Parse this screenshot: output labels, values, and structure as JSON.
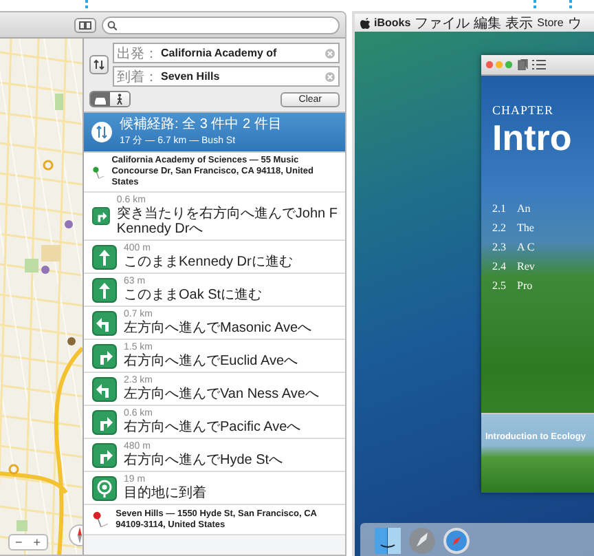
{
  "maps_window": {
    "map": {
      "zoom_out": "−",
      "zoom_in": "+"
    },
    "directions": {
      "from": {
        "label": "出発：",
        "value": "California Academy of"
      },
      "to": {
        "label": "到着：",
        "value": "Seven Hills"
      },
      "modes": [
        {
          "kind": "car",
          "selected": true
        },
        {
          "kind": "walk",
          "selected": false
        }
      ],
      "clear": "Clear",
      "route": {
        "title": "候補経路: 全 3 件中 2 件目",
        "detail": "17 分 — 6.7 km — Bush St",
        "selected": true
      },
      "start": "California Academy of Sciences — 55 Music Concourse Dr, San Francisco, CA  94118, United States",
      "steps": [
        {
          "kind": "right",
          "distance": "0.6 km",
          "instruction": "突き当たりを右方向へ進んでJohn F Kennedy Drへ"
        },
        {
          "kind": "straight",
          "distance": "400 m",
          "instruction": "このままKennedy Drに進む"
        },
        {
          "kind": "straight",
          "distance": "63 m",
          "instruction": "このままOak Stに進む"
        },
        {
          "kind": "left",
          "distance": "0.7 km",
          "instruction": "左方向へ進んでMasonic Aveへ"
        },
        {
          "kind": "right",
          "distance": "1.5 km",
          "instruction": "右方向へ進んでEuclid Aveへ"
        },
        {
          "kind": "left",
          "distance": "2.3 km",
          "instruction": "左方向へ進んでVan Ness Aveへ"
        },
        {
          "kind": "right",
          "distance": "0.6 km",
          "instruction": "右方向へ進んでPacific Aveへ"
        },
        {
          "kind": "right",
          "distance": "480 m",
          "instruction": "右方向へ進んでHyde Stへ"
        },
        {
          "kind": "arrive",
          "distance": "19 m",
          "instruction": "目的地に到着"
        }
      ],
      "end": "Seven Hills — 1550 Hyde St, San Francisco, CA  94109-3114, United States"
    }
  },
  "desktop": {
    "menu_bar": [
      "iBooks",
      "ファイル",
      "編集",
      "表示",
      "Store",
      "ウ"
    ],
    "ibooks_window": {
      "chapter_label": "CHAPTER",
      "chapter_title": "Intro",
      "contents": [
        {
          "number": "2.1",
          "title": "An"
        },
        {
          "number": "2.2",
          "title": "The"
        },
        {
          "number": "2.3",
          "title": "A C"
        },
        {
          "number": "2.4",
          "title": "Rev"
        },
        {
          "number": "2.5",
          "title": "Pro"
        }
      ],
      "thumbnail_title": "Introduction to Ecology"
    }
  }
}
